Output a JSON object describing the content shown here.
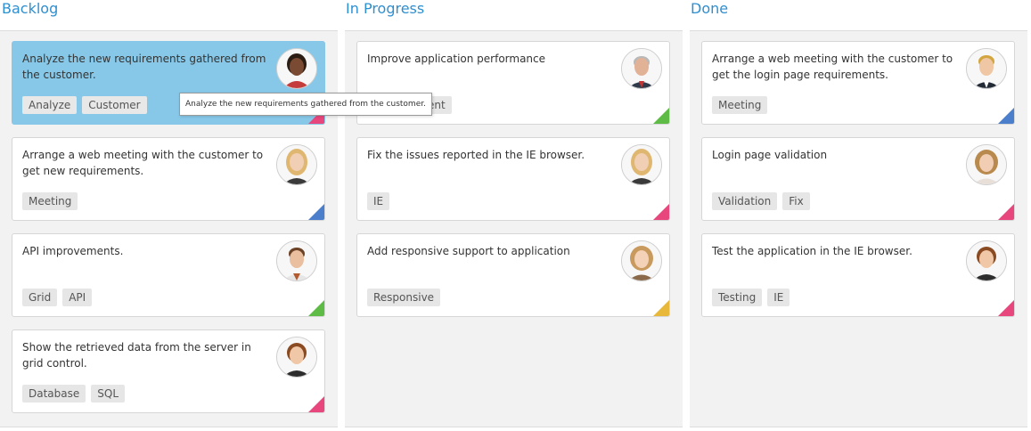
{
  "columns": [
    {
      "title": "Backlog",
      "cards": [
        {
          "text": "Analyze the new requirements gathered from the customer.",
          "tags": [
            "Analyze",
            "Customer"
          ],
          "priority_color": "#e8477d",
          "selected": true,
          "avatar": "woman-dark-hair-avatar"
        },
        {
          "text": "Arrange a web meeting with the customer to get new requirements.",
          "tags": [
            "Meeting"
          ],
          "priority_color": "#4b7fcc",
          "avatar": "woman-blonde-avatar"
        },
        {
          "text": "API improvements.",
          "tags": [
            "Grid",
            "API"
          ],
          "priority_color": "#5dbb46",
          "avatar": "man-smiling-avatar"
        },
        {
          "text": "Show the retrieved data from the server in grid control.",
          "tags": [
            "Database",
            "SQL"
          ],
          "priority_color": "#e8477d",
          "avatar": "woman-short-hair-avatar"
        }
      ]
    },
    {
      "title": "In Progress",
      "cards": [
        {
          "text": "Improve application performance",
          "tags": [
            "Improvement"
          ],
          "priority_color": "#5dbb46",
          "avatar": "man-gray-hair-avatar"
        },
        {
          "text": "Fix the issues reported in the IE browser.",
          "tags": [
            "IE"
          ],
          "priority_color": "#e8477d",
          "avatar": "woman-blonde-avatar"
        },
        {
          "text": "Add responsive support to application",
          "tags": [
            "Responsive"
          ],
          "priority_color": "#e8b83a",
          "avatar": "woman-curly-hair-avatar"
        }
      ]
    },
    {
      "title": "Done",
      "cards": [
        {
          "text": "Arrange a web meeting with the customer to get the login page requirements.",
          "tags": [
            "Meeting"
          ],
          "priority_color": "#4b7fcc",
          "avatar": "man-blonde-avatar"
        },
        {
          "text": "Login page validation",
          "tags": [
            "Validation",
            "Fix"
          ],
          "priority_color": "#e8477d",
          "avatar": "woman-wavy-hair-avatar"
        },
        {
          "text": "Test the application in the IE browser.",
          "tags": [
            "Testing",
            "IE"
          ],
          "priority_color": "#e8477d",
          "avatar": "woman-short-hair-avatar"
        }
      ]
    }
  ],
  "tooltip": "Analyze the new requirements gathered from the customer.",
  "colors": {
    "accent": "#2e8fd0",
    "selected_card": "#87c8e8",
    "column_bg": "#f2f2f2"
  }
}
